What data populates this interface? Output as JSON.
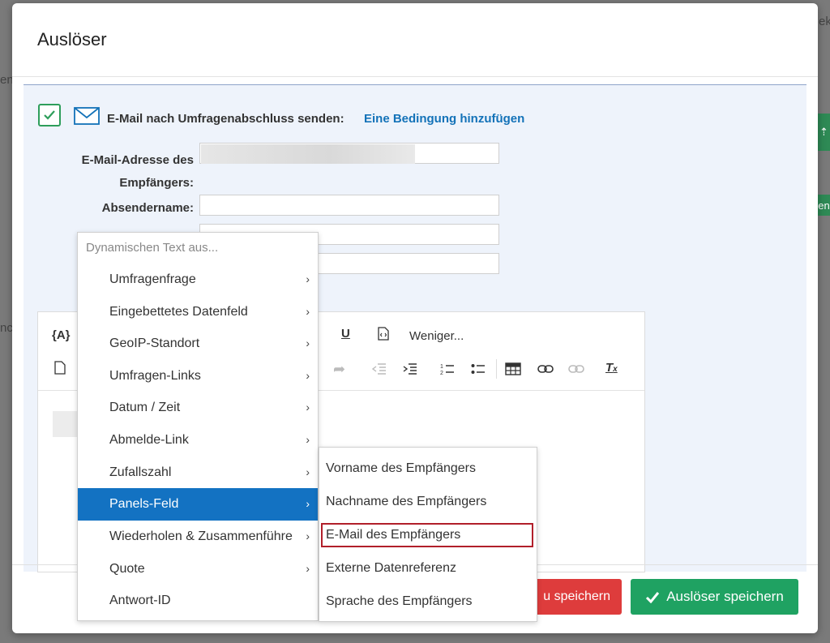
{
  "background": {
    "frag_top_right": "ek",
    "frag_left1": "en",
    "frag_left2": "nc",
    "green_btn2": "en"
  },
  "modal": {
    "title": "Auslöser"
  },
  "trigger": {
    "send_label": "E-Mail nach Umfragenabschluss senden:",
    "condition_link": "Eine Bedingung hinzufügen"
  },
  "fields": {
    "recipient_label_line1": "E-Mail-Adresse des",
    "recipient_label_line2": "Empfängers:",
    "sender_label": "Absendername:"
  },
  "editor": {
    "less_label": "Weniger..."
  },
  "menu": {
    "header": "Dynamischen Text aus...",
    "items": [
      {
        "label": "Umfragenfrage",
        "chevron": "›"
      },
      {
        "label": "Eingebettetes Datenfeld",
        "chevron": "›"
      },
      {
        "label": "GeoIP-Standort",
        "chevron": "›"
      },
      {
        "label": "Umfragen-Links",
        "chevron": "›"
      },
      {
        "label": "Datum / Zeit",
        "chevron": "›"
      },
      {
        "label": "Abmelde-Link",
        "chevron": "›"
      },
      {
        "label": "Zufallszahl",
        "chevron": "›"
      },
      {
        "label": "Panels-Feld",
        "chevron": "›"
      },
      {
        "label": "Wiederholen & Zusammenführe",
        "chevron": "›"
      },
      {
        "label": "Quote",
        "chevron": "›"
      },
      {
        "label": "Antwort-ID",
        "chevron": ""
      }
    ]
  },
  "submenu": {
    "items": [
      {
        "label": "Vorname des Empfängers"
      },
      {
        "label": "Nachname des Empfängers"
      },
      {
        "label": "E-Mail des Empfängers"
      },
      {
        "label": "Externe Datenreferenz"
      },
      {
        "label": "Sprache des Empfängers"
      }
    ]
  },
  "footer": {
    "save_partial": "u speichern",
    "save_trigger": "Auslöser speichern"
  },
  "colors": {
    "primary_blue": "#1372c2",
    "green": "#1fa262",
    "red": "#de3c3c",
    "highlight": "#b11f2a"
  }
}
